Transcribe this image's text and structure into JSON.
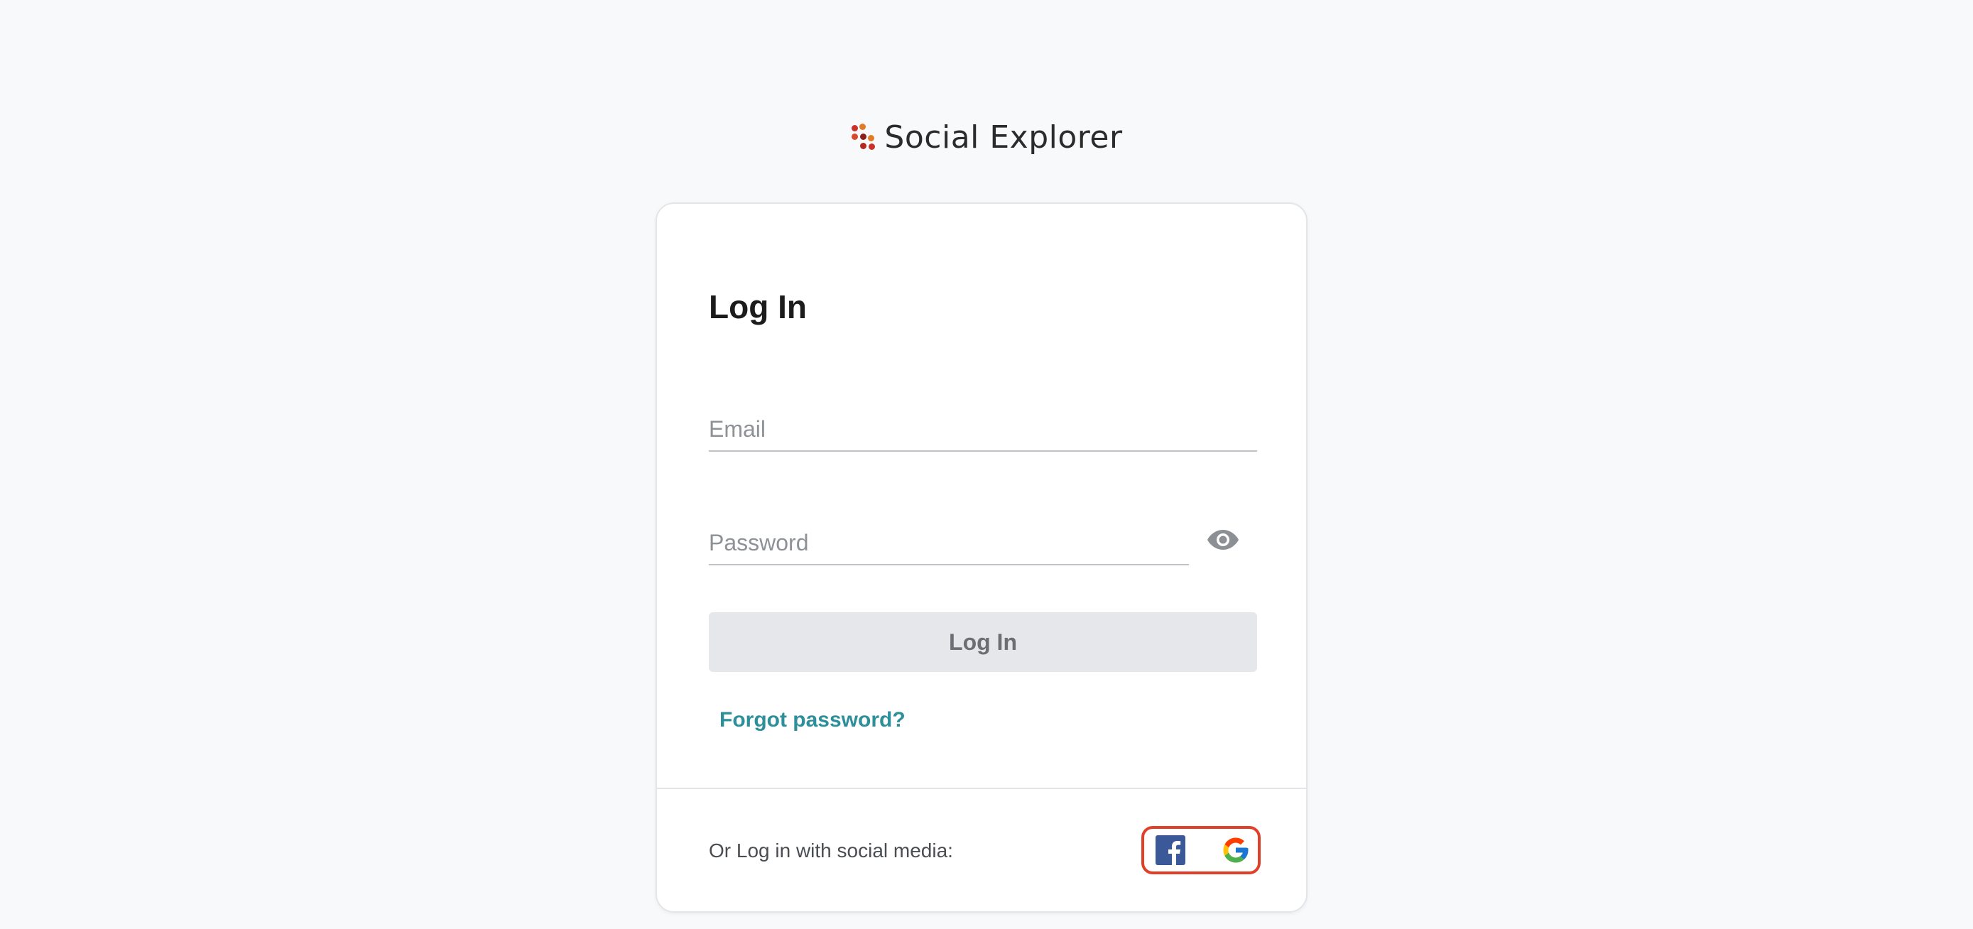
{
  "brand": {
    "name": "Social Explorer",
    "logo_icon": "dots-logo-icon",
    "dot_colors": [
      "#c8322b",
      "#e07b2a",
      "#8a1f1a",
      "#d84a2f",
      "#b3281f"
    ]
  },
  "login": {
    "title": "Log In",
    "email": {
      "placeholder": "Email",
      "value": ""
    },
    "password": {
      "placeholder": "Password",
      "value": "",
      "toggle_icon": "eye-icon"
    },
    "submit_label": "Log In",
    "forgot_label": "Forgot password?"
  },
  "social": {
    "label": "Or Log in with social media:",
    "providers": [
      {
        "name": "facebook",
        "icon": "facebook-icon",
        "color": "#3b5998"
      },
      {
        "name": "google",
        "icon": "google-icon"
      }
    ],
    "highlight_color": "#e0402a"
  },
  "colors": {
    "background": "#f8f9fb",
    "link": "#2c8f99",
    "button_bg": "#e6e7ea",
    "button_text": "#6b6e73"
  }
}
